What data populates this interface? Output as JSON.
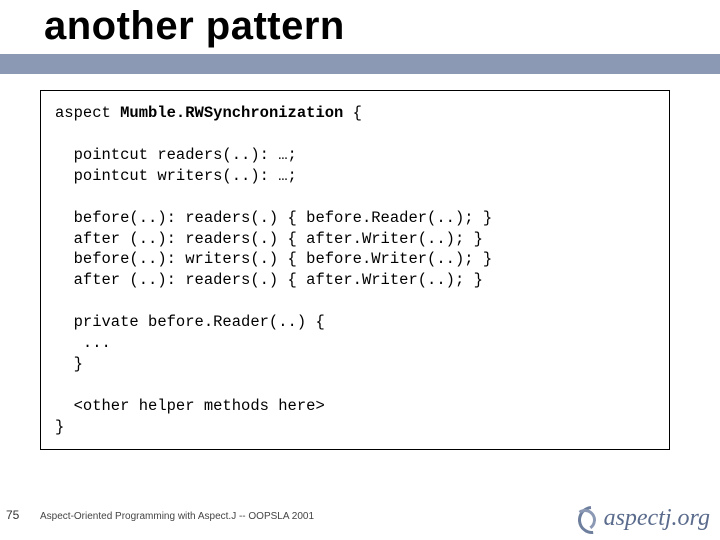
{
  "title": "another pattern",
  "code": {
    "l1_pre": "aspect ",
    "l1_b": "Mumble.RWSynchronization",
    "l1_post": " {",
    "l2": "",
    "l3": "  pointcut readers(..): …;",
    "l4": "  pointcut writers(..): …;",
    "l5": "",
    "l6": "  before(..): readers(.) { before.Reader(..); }",
    "l7": "  after (..): readers(.) { after.Writer(..); }",
    "l8": "  before(..): writers(.) { before.Writer(..); }",
    "l9": "  after (..): readers(.) { after.Writer(..); }",
    "l10": "",
    "l11": "  private before.Reader(..) {",
    "l12": "   ...",
    "l13": "  }",
    "l14": "",
    "l15": "  <other helper methods here>",
    "l16": "}"
  },
  "slide_number": "75",
  "footer": "Aspect-Oriented Programming with Aspect.J -- OOPSLA 2001",
  "logo_text": "aspectj.org"
}
